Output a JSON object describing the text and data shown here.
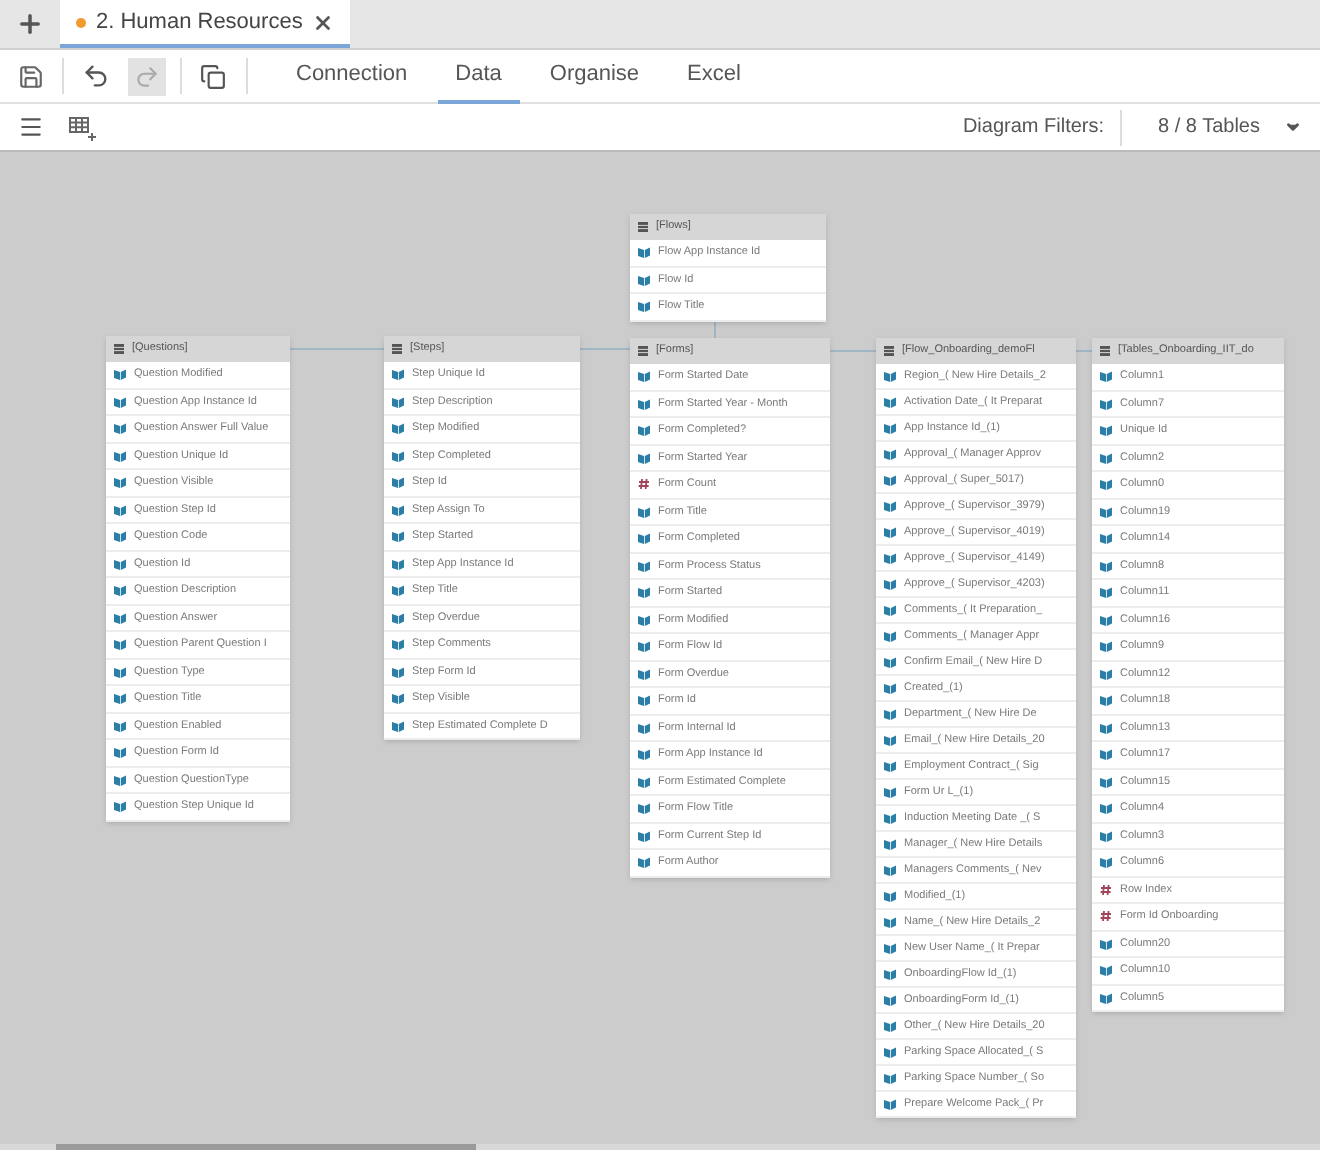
{
  "document_tab": {
    "title": "2. Human Resources",
    "unsaved": true
  },
  "toolbar": {
    "redo_disabled": true,
    "tabs": [
      {
        "label": "Connection",
        "selected": false
      },
      {
        "label": "Data",
        "selected": true
      },
      {
        "label": "Organise",
        "selected": false
      },
      {
        "label": "Excel",
        "selected": false
      }
    ]
  },
  "filters": {
    "label": "Diagram Filters:",
    "value": "8 / 8 Tables"
  },
  "tables": [
    {
      "name": "[Questions]",
      "fields": [
        {
          "name": "Question Modified",
          "kind": "text"
        },
        {
          "name": "Question App Instance Id",
          "kind": "text"
        },
        {
          "name": "Question Answer Full Value",
          "kind": "text"
        },
        {
          "name": "Question Unique Id",
          "kind": "text"
        },
        {
          "name": "Question Visible",
          "kind": "text"
        },
        {
          "name": "Question Step Id",
          "kind": "text"
        },
        {
          "name": "Question Code",
          "kind": "text"
        },
        {
          "name": "Question Id",
          "kind": "text"
        },
        {
          "name": "Question Description",
          "kind": "text"
        },
        {
          "name": "Question Answer",
          "kind": "text"
        },
        {
          "name": "Question Parent Question I",
          "kind": "text"
        },
        {
          "name": "Question Type",
          "kind": "text"
        },
        {
          "name": "Question Title",
          "kind": "text"
        },
        {
          "name": "Question Enabled",
          "kind": "text"
        },
        {
          "name": "Question Form Id",
          "kind": "text"
        },
        {
          "name": "Question QuestionType",
          "kind": "text"
        },
        {
          "name": "Question Step Unique Id",
          "kind": "text"
        }
      ]
    },
    {
      "name": "[Steps]",
      "fields": [
        {
          "name": "Step Unique Id",
          "kind": "text"
        },
        {
          "name": "Step Description",
          "kind": "text"
        },
        {
          "name": "Step Modified",
          "kind": "text"
        },
        {
          "name": "Step Completed",
          "kind": "text"
        },
        {
          "name": "Step Id",
          "kind": "text"
        },
        {
          "name": "Step Assign To",
          "kind": "text"
        },
        {
          "name": "Step Started",
          "kind": "text"
        },
        {
          "name": "Step App Instance Id",
          "kind": "text"
        },
        {
          "name": "Step Title",
          "kind": "text"
        },
        {
          "name": "Step Overdue",
          "kind": "text"
        },
        {
          "name": "Step Comments",
          "kind": "text"
        },
        {
          "name": "Step Form Id",
          "kind": "text"
        },
        {
          "name": "Step Visible",
          "kind": "text"
        },
        {
          "name": "Step Estimated Complete D",
          "kind": "text"
        }
      ]
    },
    {
      "name": "[Flows]",
      "fields": [
        {
          "name": "Flow App Instance Id",
          "kind": "text"
        },
        {
          "name": "Flow Id",
          "kind": "text"
        },
        {
          "name": "Flow Title",
          "kind": "text"
        }
      ]
    },
    {
      "name": "[Forms]",
      "fields": [
        {
          "name": "Form Started Date",
          "kind": "text"
        },
        {
          "name": "Form Started Year - Month",
          "kind": "text"
        },
        {
          "name": "Form Completed?",
          "kind": "text"
        },
        {
          "name": "Form Started Year",
          "kind": "text"
        },
        {
          "name": "Form Count",
          "kind": "number"
        },
        {
          "name": "Form Title",
          "kind": "text"
        },
        {
          "name": "Form Completed",
          "kind": "text"
        },
        {
          "name": "Form Process Status",
          "kind": "text"
        },
        {
          "name": "Form Started",
          "kind": "text"
        },
        {
          "name": "Form Modified",
          "kind": "text"
        },
        {
          "name": "Form Flow Id",
          "kind": "text"
        },
        {
          "name": "Form Overdue",
          "kind": "text"
        },
        {
          "name": "Form Id",
          "kind": "text"
        },
        {
          "name": "Form Internal Id",
          "kind": "text"
        },
        {
          "name": "Form App Instance Id",
          "kind": "text"
        },
        {
          "name": "Form Estimated Complete",
          "kind": "text"
        },
        {
          "name": "Form Flow Title",
          "kind": "text"
        },
        {
          "name": "Form Current Step Id",
          "kind": "text"
        },
        {
          "name": "Form Author",
          "kind": "text"
        }
      ]
    },
    {
      "name": "[Flow_Onboarding_demoFl",
      "fields": [
        {
          "name": "Region_( New Hire Details_2",
          "kind": "text"
        },
        {
          "name": "Activation Date_( It Preparat",
          "kind": "text"
        },
        {
          "name": "App Instance Id_(1)",
          "kind": "text"
        },
        {
          "name": "Approval_( Manager Approv",
          "kind": "text"
        },
        {
          "name": "Approval_( Super_5017)",
          "kind": "text"
        },
        {
          "name": "Approve_( Supervisor_3979)",
          "kind": "text"
        },
        {
          "name": "Approve_( Supervisor_4019)",
          "kind": "text"
        },
        {
          "name": "Approve_( Supervisor_4149)",
          "kind": "text"
        },
        {
          "name": "Approve_( Supervisor_4203)",
          "kind": "text"
        },
        {
          "name": "Comments_( It Preparation_",
          "kind": "text"
        },
        {
          "name": "Comments_( Manager Appr",
          "kind": "text"
        },
        {
          "name": "Confirm Email_( New Hire D",
          "kind": "text"
        },
        {
          "name": "Created_(1)",
          "kind": "text"
        },
        {
          "name": "Department_( New Hire De",
          "kind": "text"
        },
        {
          "name": "Email_( New Hire Details_20",
          "kind": "text"
        },
        {
          "name": "Employment Contract_( Sig",
          "kind": "text"
        },
        {
          "name": "Form Ur L_(1)",
          "kind": "text"
        },
        {
          "name": "Induction Meeting Date _( S",
          "kind": "text"
        },
        {
          "name": "Manager_( New Hire Details",
          "kind": "text"
        },
        {
          "name": "Managers Comments_( Nev",
          "kind": "text"
        },
        {
          "name": "Modified_(1)",
          "kind": "text"
        },
        {
          "name": "Name_( New Hire Details_2",
          "kind": "text"
        },
        {
          "name": "New User Name_( It Prepar",
          "kind": "text"
        },
        {
          "name": "OnboardingFlow Id_(1)",
          "kind": "text"
        },
        {
          "name": "OnboardingForm Id_(1)",
          "kind": "text"
        },
        {
          "name": "Other_( New Hire Details_20",
          "kind": "text"
        },
        {
          "name": "Parking Space Allocated_( S",
          "kind": "text"
        },
        {
          "name": "Parking Space Number_( So",
          "kind": "text"
        },
        {
          "name": "Prepare Welcome Pack_( Pr",
          "kind": "text"
        }
      ]
    },
    {
      "name": "[Tables_Onboarding_IIT_do",
      "fields": [
        {
          "name": "Column1",
          "kind": "text"
        },
        {
          "name": "Column7",
          "kind": "text"
        },
        {
          "name": "Unique Id",
          "kind": "text"
        },
        {
          "name": "Column2",
          "kind": "text"
        },
        {
          "name": "Column0",
          "kind": "text"
        },
        {
          "name": "Column19",
          "kind": "text"
        },
        {
          "name": "Column14",
          "kind": "text"
        },
        {
          "name": "Column8",
          "kind": "text"
        },
        {
          "name": "Column11",
          "kind": "text"
        },
        {
          "name": "Column16",
          "kind": "text"
        },
        {
          "name": "Column9",
          "kind": "text"
        },
        {
          "name": "Column12",
          "kind": "text"
        },
        {
          "name": "Column18",
          "kind": "text"
        },
        {
          "name": "Column13",
          "kind": "text"
        },
        {
          "name": "Column17",
          "kind": "text"
        },
        {
          "name": "Column15",
          "kind": "text"
        },
        {
          "name": "Column4",
          "kind": "text"
        },
        {
          "name": "Column3",
          "kind": "text"
        },
        {
          "name": "Column6",
          "kind": "text"
        },
        {
          "name": "Row Index",
          "kind": "number"
        },
        {
          "name": "Form Id Onboarding",
          "kind": "number"
        },
        {
          "name": "Column20",
          "kind": "text"
        },
        {
          "name": "Column10",
          "kind": "text"
        },
        {
          "name": "Column5",
          "kind": "text"
        }
      ]
    }
  ]
}
